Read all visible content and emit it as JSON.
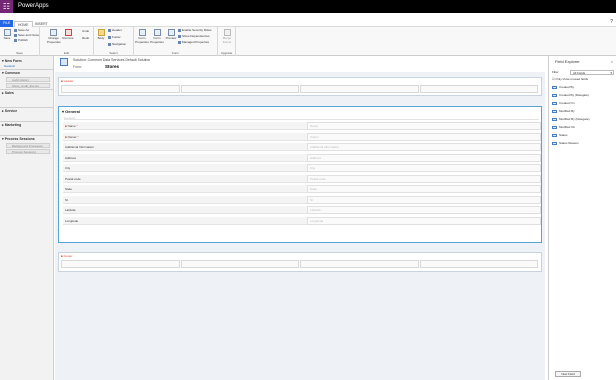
{
  "app": {
    "title": "PowerApps",
    "waffle": "waffle-icon"
  },
  "tabs": {
    "file": "FILE",
    "home": "HOME",
    "insert": "INSERT"
  },
  "help": "?",
  "ribbon": {
    "save_group": {
      "save": "Save",
      "save_as": "Save As",
      "save_close": "Save and Close",
      "publish": "Publish",
      "label": "Save"
    },
    "edit_group": {
      "change_properties": "Change Properties",
      "remove": "Remove",
      "undo": "Undo",
      "redo": "Redo",
      "label": "Edit"
    },
    "select_group": {
      "body": "Body",
      "header": "Header",
      "footer": "Footer",
      "navigation": "Navigation",
      "label": "Select"
    },
    "form_group": {
      "form_properties": "Form Properties",
      "form_properties2": "Form Properties",
      "preview": "Preview",
      "enable_security_roles": "Enable Security Roles",
      "show_dependencies": "Show Dependencies",
      "managed_properties": "Managed Properties",
      "label": "Form"
    },
    "upgrade_group": {
      "merge_forms": "Merge Forms",
      "label": "Upgrade"
    }
  },
  "nav": {
    "new_form": "New Form",
    "general": "General",
    "common": "Common",
    "audit_history": "Audit History",
    "show_audit_events": "Show_Audit_Events",
    "sales": "Sales",
    "service": "Service",
    "marketing": "Marketing",
    "process_sessions": "Process Sessions",
    "background_processes": "Background Processes",
    "process_sessions_item": "Process Sessions"
  },
  "solution": {
    "title": "Solution: Common Data Services Default Solution",
    "form_label": "Form:",
    "form_name": "Stores"
  },
  "form": {
    "header_label": "Header",
    "general_title": "General",
    "general_sub": "General",
    "footer_label": "Footer",
    "fields": [
      {
        "label": "Name",
        "required": true,
        "value": "Name"
      },
      {
        "label": "Owner",
        "required": true,
        "value": "Owner"
      },
      {
        "label": "Additional Information",
        "required": false,
        "value": "Additional Information"
      },
      {
        "label": "Address",
        "required": false,
        "value": "Address"
      },
      {
        "label": "City",
        "required": false,
        "value": "City"
      },
      {
        "label": "Postal code",
        "required": false,
        "value": "Postal code"
      },
      {
        "label": "State",
        "required": false,
        "value": "State"
      },
      {
        "label": "St",
        "required": false,
        "value": "St"
      },
      {
        "label": "Latitude",
        "required": false,
        "value": "Latitude"
      },
      {
        "label": "Longitude",
        "required": false,
        "value": "Longitude"
      }
    ]
  },
  "field_explorer": {
    "title": "Field Explorer",
    "close": "×",
    "filter_label": "Filter",
    "filter_value": "All Fields",
    "only_unused": "Only show unused fields",
    "items": [
      "Created By",
      "Created By (Delegate)",
      "Created On",
      "Modified By",
      "Modified By (Delegate)",
      "Modified On",
      "Status",
      "Status Reason"
    ],
    "new_field": "New Field"
  }
}
